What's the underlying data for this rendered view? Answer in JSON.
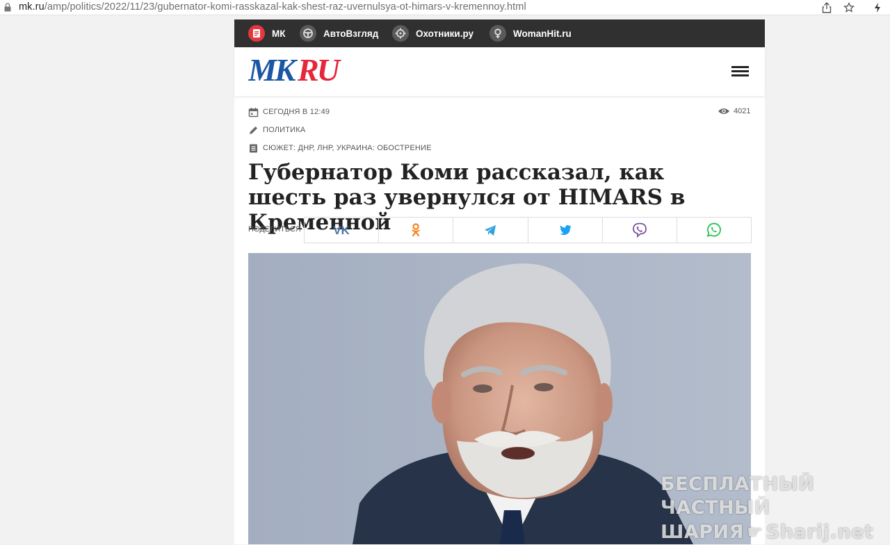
{
  "browser": {
    "url_host": "mk.ru",
    "url_path": "/amp/politics/2022/11/23/gubernator-komi-rasskazal-kak-shest-raz-uvernulsya-ot-himars-v-kremennoy.html"
  },
  "network_bar": {
    "items": [
      {
        "label": "МК",
        "icon": "mk-doc-icon",
        "color": "#e8363f"
      },
      {
        "label": "АвтоВзгляд",
        "icon": "steering-wheel-icon",
        "color": "#5a5a5a"
      },
      {
        "label": "Охотники.ру",
        "icon": "crosshair-icon",
        "color": "#5a5a5a"
      },
      {
        "label": "WomanHit.ru",
        "icon": "female-symbol-icon",
        "color": "#5a5a5a"
      }
    ]
  },
  "header": {
    "logo_text": "MKRU",
    "logo_colors": {
      "mk": "#1b57a4",
      "ru": "#e6263a"
    }
  },
  "article": {
    "date": "сегодня в 12:49",
    "rubric": "политика",
    "story": "сюжет: ДНР, ЛНР, Украина: обострение",
    "views": "4021",
    "title": "Губернатор Коми рассказал, как шесть раз увернулся от HIMARS в Кременной"
  },
  "share": {
    "label": "поделиться",
    "buttons": [
      {
        "name": "vk",
        "icon": "vk-icon",
        "color": "#4a76a8"
      },
      {
        "name": "odnoklassniki",
        "icon": "odnoklassniki-icon",
        "color": "#f58220"
      },
      {
        "name": "telegram",
        "icon": "telegram-icon",
        "color": "#2aa3df"
      },
      {
        "name": "twitter",
        "icon": "twitter-icon",
        "color": "#1da1f2"
      },
      {
        "name": "viber",
        "icon": "viber-icon",
        "color": "#7d51a0"
      },
      {
        "name": "whatsapp",
        "icon": "whatsapp-icon",
        "color": "#2fc35a"
      }
    ]
  },
  "watermark": {
    "line1": "БЕСПЛАТНЫЙ ЧАСТНЫЙ",
    "line2_left": "ШАРИЯ",
    "line2_right": "Sharij.net"
  }
}
